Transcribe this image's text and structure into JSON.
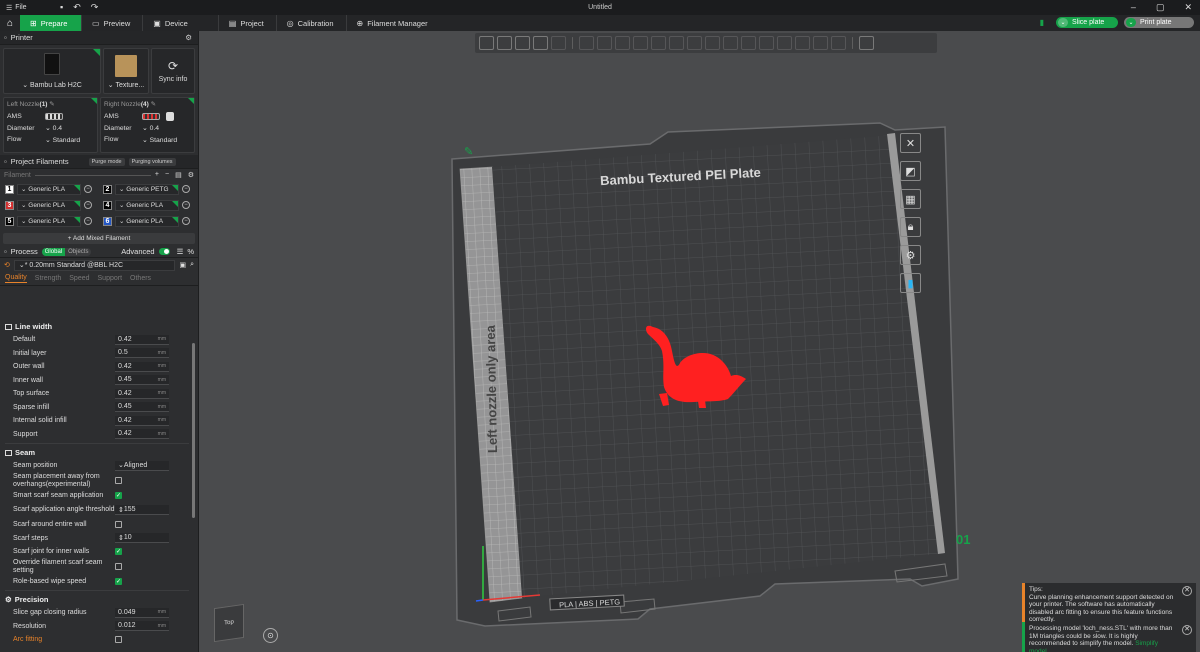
{
  "titlebar": {
    "menu_label": "File",
    "title": "Untitled"
  },
  "tabs": [
    {
      "label": "Prepare",
      "icon": "prepare-icon"
    },
    {
      "label": "Preview",
      "icon": "preview-icon"
    },
    {
      "label": "Device",
      "icon": "device-icon"
    },
    {
      "label": "Project",
      "icon": "project-icon"
    },
    {
      "label": "Calibration",
      "icon": "calibration-icon"
    },
    {
      "label": "Filament Manager",
      "icon": "filament-manager-icon"
    }
  ],
  "actions": {
    "slice": "Slice plate",
    "print": "Print plate"
  },
  "printer": {
    "section_title": "Printer",
    "printer_name": "Bambu Lab H2C",
    "plate_name": "Texture...",
    "sync_label": "Sync info",
    "left_nozzle": {
      "title": "Left Nozzle",
      "count": "(1)",
      "ams": "AMS",
      "diameter_label": "Diameter",
      "diameter": "0.4",
      "flow_label": "Flow",
      "flow": "Standard"
    },
    "right_nozzle": {
      "title": "Right Nozzle",
      "count": "(4)",
      "ams": "AMS",
      "diameter_label": "Diameter",
      "diameter": "0.4",
      "flow_label": "Flow",
      "flow": "Standard"
    }
  },
  "filaments": {
    "section_title": "Project Filaments",
    "purge_mode": "Purge mode",
    "purging_volumes": "Purging volumes",
    "filter_label": "Filament",
    "items": [
      {
        "num": "1",
        "name": "Generic PLA",
        "color": "#ffffff",
        "text_color": "#000000"
      },
      {
        "num": "2",
        "name": "Generic PETG",
        "color": "#000000",
        "text_color": "#ffffff"
      },
      {
        "num": "3",
        "name": "Generic PLA",
        "color": "#d32f2f",
        "text_color": "#ffffff"
      },
      {
        "num": "4",
        "name": "Generic PLA",
        "color": "#000000",
        "text_color": "#ffffff"
      },
      {
        "num": "5",
        "name": "Generic PLA",
        "color": "#000000",
        "text_color": "#ffffff"
      },
      {
        "num": "6",
        "name": "Generic PLA",
        "color": "#2457c5",
        "text_color": "#ffffff"
      }
    ],
    "add_mixed": "+ Add Mixed Filament"
  },
  "process": {
    "section_title": "Process",
    "scope_global": "Global",
    "scope_objects": "Objects",
    "advanced_label": "Advanced",
    "preset": "* 0.20mm Standard @BBL H2C",
    "subtabs": [
      "Quality",
      "Strength",
      "Speed",
      "Support",
      "Others"
    ]
  },
  "params": {
    "line_width": {
      "title": "Line width",
      "rows": [
        {
          "label": "Default",
          "value": "0.42",
          "unit": "mm"
        },
        {
          "label": "Initial layer",
          "value": "0.5",
          "unit": "mm"
        },
        {
          "label": "Outer wall",
          "value": "0.42",
          "unit": "mm"
        },
        {
          "label": "Inner wall",
          "value": "0.45",
          "unit": "mm"
        },
        {
          "label": "Top surface",
          "value": "0.42",
          "unit": "mm"
        },
        {
          "label": "Sparse infill",
          "value": "0.45",
          "unit": "mm"
        },
        {
          "label": "Internal solid infill",
          "value": "0.42",
          "unit": "mm"
        },
        {
          "label": "Support",
          "value": "0.42",
          "unit": "mm"
        }
      ]
    },
    "seam": {
      "title": "Seam",
      "position_label": "Seam position",
      "position_value": "Aligned",
      "away_label": "Seam placement away from overhangs(experimental)",
      "smart_label": "Smart scarf seam application",
      "angle_label": "Scarf application angle threshold",
      "angle_value": "155",
      "around_label": "Scarf around entire wall",
      "steps_label": "Scarf steps",
      "steps_value": "10",
      "inner_label": "Scarf joint for inner walls",
      "override_label": "Override filament scarf seam setting",
      "wipe_label": "Role-based wipe speed"
    },
    "precision": {
      "title": "Precision",
      "slice_gap_label": "Slice gap closing radius",
      "slice_gap_value": "0.049",
      "slice_gap_unit": "mm",
      "resolution_label": "Resolution",
      "resolution_value": "0.012",
      "resolution_unit": "mm",
      "arc_label": "Arc fitting"
    }
  },
  "plate": {
    "title": "Bambu Textured PEI Plate",
    "left_area_label": "Left nozzle only area",
    "plate_number": "01",
    "footer_label": "PLA | ABS | PETG",
    "model_color": "#ff2020"
  },
  "viewcube_label": "Top",
  "notifications": {
    "tips": {
      "title": "Tips:",
      "text": "Curve planning enhancement support detected on your printer. The software has automatically disabled arc fitting to ensure this feature functions correctly."
    },
    "processing": {
      "text": "Processing model 'loch_ness.STL' with more than 1M triangles could be slow. It is highly recommended to simplify the model.",
      "link": "Simplify model"
    }
  }
}
